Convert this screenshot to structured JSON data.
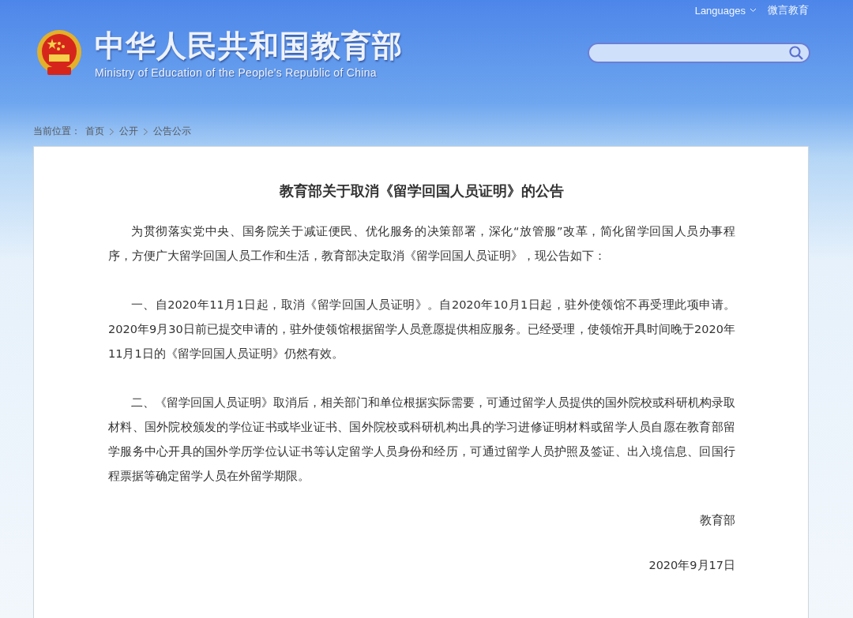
{
  "header": {
    "title": "中华人民共和国教育部",
    "subtitle": "Ministry of Education of the People's Republic of China",
    "top_links": [
      {
        "label": "Languages",
        "kind": "dropdown"
      },
      {
        "label": "微言教育",
        "kind": "link"
      }
    ]
  },
  "breadcrumb": {
    "label": "当前位置：",
    "items": [
      "首页",
      "公开",
      "公告公示"
    ]
  },
  "article": {
    "title": "教育部关于取消《留学回国人员证明》的公告",
    "paragraphs": [
      "为贯彻落实党中央、国务院关于减证便民、优化服务的决策部署，深化“放管服”改革，简化留学回国人员办事程序，方便广大留学回国人员工作和生活，教育部决定取消《留学回国人员证明》，现公告如下：",
      "一、自2020年11月1日起，取消《留学回国人员证明》。自2020年10月1日起，驻外使领馆不再受理此项申请。2020年9月30日前已提交申请的，驻外使领馆根据留学人员意愿提供相应服务。已经受理，使领馆开具时间晚于2020年11月1日的《留学回国人员证明》仍然有效。",
      "二、《留学回国人员证明》取消后，相关部门和单位根据实际需要，可通过留学人员提供的国外院校或科研机构录取材料、国外院校颁发的学位证书或毕业证书、国外院校或科研机构出具的学习进修证明材料或留学人员自愿在教育部留学服务中心开具的国外学历学位认证书等认定留学人员身份和经历，可通过留学人员护照及签证、出入境信息、回国行程票据等确定留学人员在外留学期限。"
    ],
    "signature": "教育部",
    "date": "2020年9月17日"
  }
}
